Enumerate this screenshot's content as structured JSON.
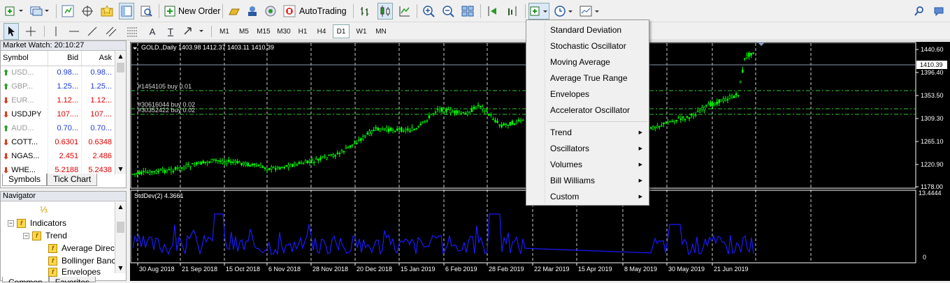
{
  "toolbar": {
    "new_order_label": "New Order",
    "autotrading_label": "AutoTrading",
    "timeframes": [
      "M1",
      "M5",
      "M15",
      "M30",
      "H1",
      "H4",
      "D1",
      "W1",
      "MN"
    ],
    "active_timeframe": "D1",
    "text_tool_label": "A",
    "text_label_tool": "T"
  },
  "market_watch": {
    "title": "Market Watch: 20:10:27",
    "columns": [
      "Symbol",
      "Bid",
      "Ask"
    ],
    "rows": [
      {
        "symbol": "USD...",
        "bid": "0.98...",
        "ask": "0.98...",
        "dir": "up",
        "price_color": "blue"
      },
      {
        "symbol": "GBP...",
        "bid": "1.25...",
        "ask": "1.25...",
        "dir": "up",
        "price_color": "blue"
      },
      {
        "symbol": "EUR...",
        "bid": "1.12...",
        "ask": "1.12...",
        "dir": "down",
        "price_color": "red"
      },
      {
        "symbol": "USDJPY",
        "bid": "107....",
        "ask": "107....",
        "dir": "down",
        "price_color": "red"
      },
      {
        "symbol": "AUD...",
        "bid": "0.70...",
        "ask": "0.70...",
        "dir": "up",
        "price_color": "blue"
      },
      {
        "symbol": "COTT...",
        "bid": "0.6301",
        "ask": "0.6348",
        "dir": "down",
        "price_color": "red"
      },
      {
        "symbol": "NGAS...",
        "bid": "2.451",
        "ask": "2.486",
        "dir": "down",
        "price_color": "red"
      },
      {
        "symbol": "WHE...",
        "bid": "5.2188",
        "ask": "5.2438",
        "dir": "down",
        "price_color": "red"
      }
    ],
    "tabs": [
      "Symbols",
      "Tick Chart"
    ]
  },
  "navigator": {
    "title": "Navigator",
    "items": [
      {
        "label": "Indicators",
        "level": 1
      },
      {
        "label": "Trend",
        "level": 2
      },
      {
        "label": "Average Direc",
        "level": 3
      },
      {
        "label": "Bollinger Banc",
        "level": 3
      },
      {
        "label": "Envelopes",
        "level": 3
      }
    ],
    "tabs": [
      "Common",
      "Favorites"
    ]
  },
  "chart": {
    "header": "GOLD.,Daily  1403.98 1412.37 1403.11 1410.39",
    "orders": [
      "#1454105 buy 0.01",
      "#30616044 buy 0.02",
      "#30352422 buy 0.02"
    ],
    "price_ticks": [
      "1440.60",
      "1396.40",
      "1353.50",
      "1309.30",
      "1265.10",
      "1220.90",
      "1178.00"
    ],
    "current_price": "1410.39",
    "indicator_label": "StdDev(2) 4.3661",
    "indicator_ticks": [
      "13.4444",
      "0"
    ],
    "date_ticks": [
      "30 Aug 2018",
      "21 Sep 2018",
      "15 Oct 2018",
      "6 Nov 2018",
      "28 Nov 2018",
      "20 Dec 2018",
      "15 Jan 2019",
      "6 Feb 2019",
      "28 Feb 2019",
      "22 Mar 2019",
      "15 Apr 2019",
      "8 May 2019",
      "30 May 2019",
      "21 Jun 2019"
    ],
    "colors": {
      "background": "#000000",
      "candles": "#00ff00",
      "grid": "#ffffff",
      "order_line": "#2ecc2e",
      "indicator": "#1a1aff",
      "price_line": "#8a9ab0"
    }
  },
  "context_menu": {
    "items": [
      {
        "label": "Standard Deviation",
        "submenu": false
      },
      {
        "label": "Stochastic Oscillator",
        "submenu": false
      },
      {
        "label": "Moving Average",
        "submenu": false
      },
      {
        "label": "Average True Range",
        "submenu": false
      },
      {
        "label": "Envelopes",
        "submenu": false
      },
      {
        "label": "Accelerator Oscillator",
        "submenu": false
      },
      {
        "label": "Trend",
        "submenu": true
      },
      {
        "label": "Oscillators",
        "submenu": true
      },
      {
        "label": "Volumes",
        "submenu": true
      },
      {
        "label": "Bill Williams",
        "submenu": true
      },
      {
        "label": "Custom",
        "submenu": true
      }
    ]
  }
}
